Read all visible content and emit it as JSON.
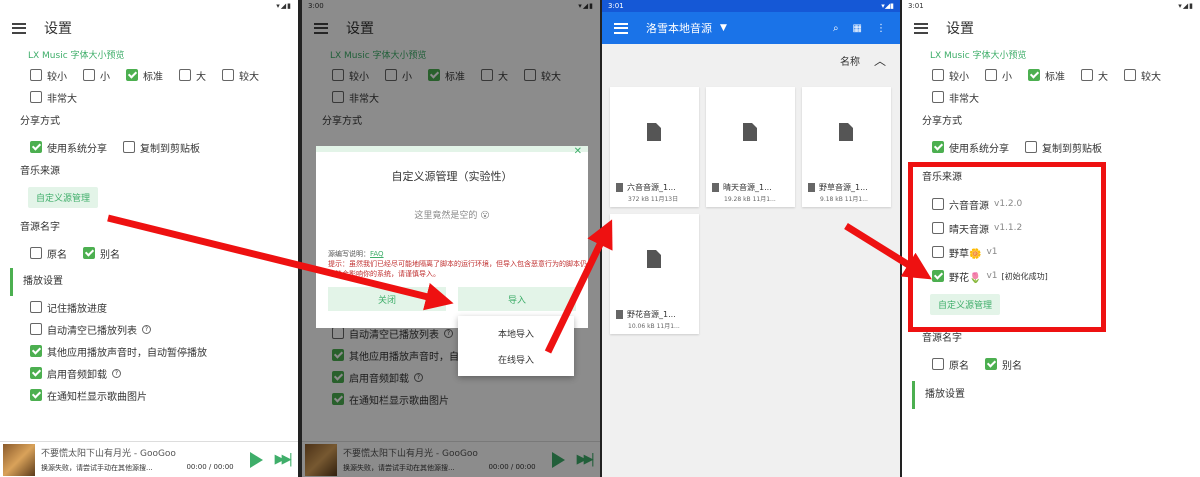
{
  "status": {
    "p1": "",
    "p2": "3:00",
    "p3": "3:01",
    "p4": "3:01"
  },
  "settings": {
    "title": "设置",
    "preview_label": "LX Music 字体大小预览",
    "font_sizes": [
      "较小",
      "小",
      "标准",
      "大",
      "较大",
      "非常大"
    ],
    "share_section": "分享方式",
    "share_system": "使用系统分享",
    "share_clipboard": "复制到剪贴板",
    "source_section": "音乐来源",
    "custom_source_button": "自定义源管理",
    "source_name_section": "音源名字",
    "name_original": "原名",
    "name_alias": "别名",
    "play_section": "播放设置",
    "play_remember": "记住播放进度",
    "play_autoclear": "自动清空已播放列表",
    "play_pause_other": "其他应用播放声音时，自动暂停播放",
    "play_audio_offload": "启用音频卸载",
    "play_notif_cover": "在通知栏显示歌曲图片"
  },
  "player": {
    "title": "不要慌太阳下山有月光 - GooGoo",
    "message": "换源失败，请尝试手动在其他源搜...",
    "time": "00:00 / 00:00"
  },
  "dialog": {
    "title": "自定义源管理（实验性）",
    "empty": "这里竟然是空的 😮",
    "doc_label": "源编写说明：",
    "doc_link": "FAQ",
    "warning": "提示：虽然我们已经尽可能地隔离了脚本的运行环境，但导入包含恶意行为的脚本仍可能会影响你的系统，请谨慎导入。",
    "close": "关闭",
    "import": "导入",
    "menu_local": "本地导入",
    "menu_online": "在线导入"
  },
  "filemanager": {
    "folder": "洛雪本地音源",
    "sort_label": "名称",
    "files": [
      {
        "name": "六音音源_1...",
        "meta": "372 kB 11月13日"
      },
      {
        "name": "晴天音源_1...",
        "meta": "19.28 kB 11月1..."
      },
      {
        "name": "野草音源_1...",
        "meta": "9.18 kB 11月1..."
      },
      {
        "name": "野花音源_1...",
        "meta": "10.06 kB 11月1..."
      }
    ]
  },
  "sources": {
    "section": "音乐来源",
    "items": [
      {
        "name": "六音音源",
        "version": "v1.2.0",
        "checked": false
      },
      {
        "name": "晴天音源",
        "version": "v1.1.2",
        "checked": false
      },
      {
        "name": "野草🌼",
        "version": "v1",
        "checked": false
      },
      {
        "name": "野花🌷",
        "version": "v1",
        "status": "[初始化成功]",
        "checked": true
      }
    ],
    "manage_button": "自定义源管理"
  },
  "colors": {
    "accent": "#4caf50",
    "highlight": "#ee1111",
    "fm_bar": "#1a73e8"
  }
}
